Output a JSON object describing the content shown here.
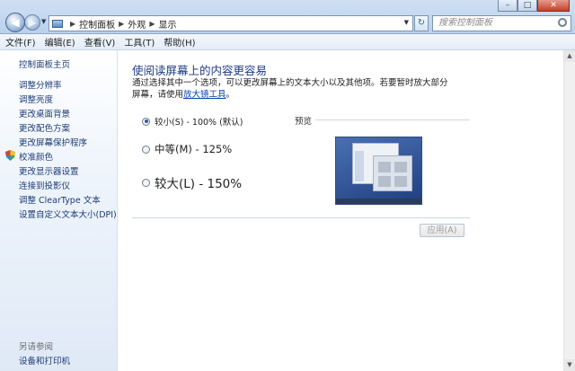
{
  "window": {
    "controls": {
      "minimize": "–",
      "maximize": "□",
      "close": "✕"
    }
  },
  "nav": {
    "back": "◀",
    "forward": "▶"
  },
  "address": {
    "breadcrumbs": [
      "控制面板",
      "外观",
      "显示"
    ]
  },
  "search": {
    "placeholder": "搜索控制面板"
  },
  "menu": [
    "文件(F)",
    "编辑(E)",
    "查看(V)",
    "工具(T)",
    "帮助(H)"
  ],
  "sidebar": {
    "items": [
      "控制面板主页",
      "调整分辨率",
      "调整亮度",
      "更改桌面背景",
      "更改配色方案",
      "更改屏幕保护程序",
      "校准颜色",
      "更改显示器设置",
      "连接到投影仪",
      "调整 ClearType 文本",
      "设置自定义文本大小(DPI)"
    ],
    "see_also": "另请参阅",
    "see_also_items": [
      "设备和打印机"
    ]
  },
  "main": {
    "title": "使阅读屏幕上的内容更容易",
    "desc_pre": "通过选择其中一个选项，可以更改屏幕上的文本大小以及其他项。若要暂时放大部分屏幕，请使用",
    "desc_link": "放大镜工具",
    "desc_post": "。",
    "options": [
      {
        "label": "较小(S) - 100% (默认)",
        "checked": true,
        "size": "small"
      },
      {
        "label": "中等(M) - 125%",
        "checked": false,
        "size": "medium"
      },
      {
        "label": "较大(L) - 150%",
        "checked": false,
        "size": "large"
      }
    ],
    "preview_label": "预览",
    "apply": "应用(A)"
  },
  "colors": {
    "title": "#1e3a87",
    "link": "#1d3b77",
    "accent": "#2a5fa8"
  }
}
